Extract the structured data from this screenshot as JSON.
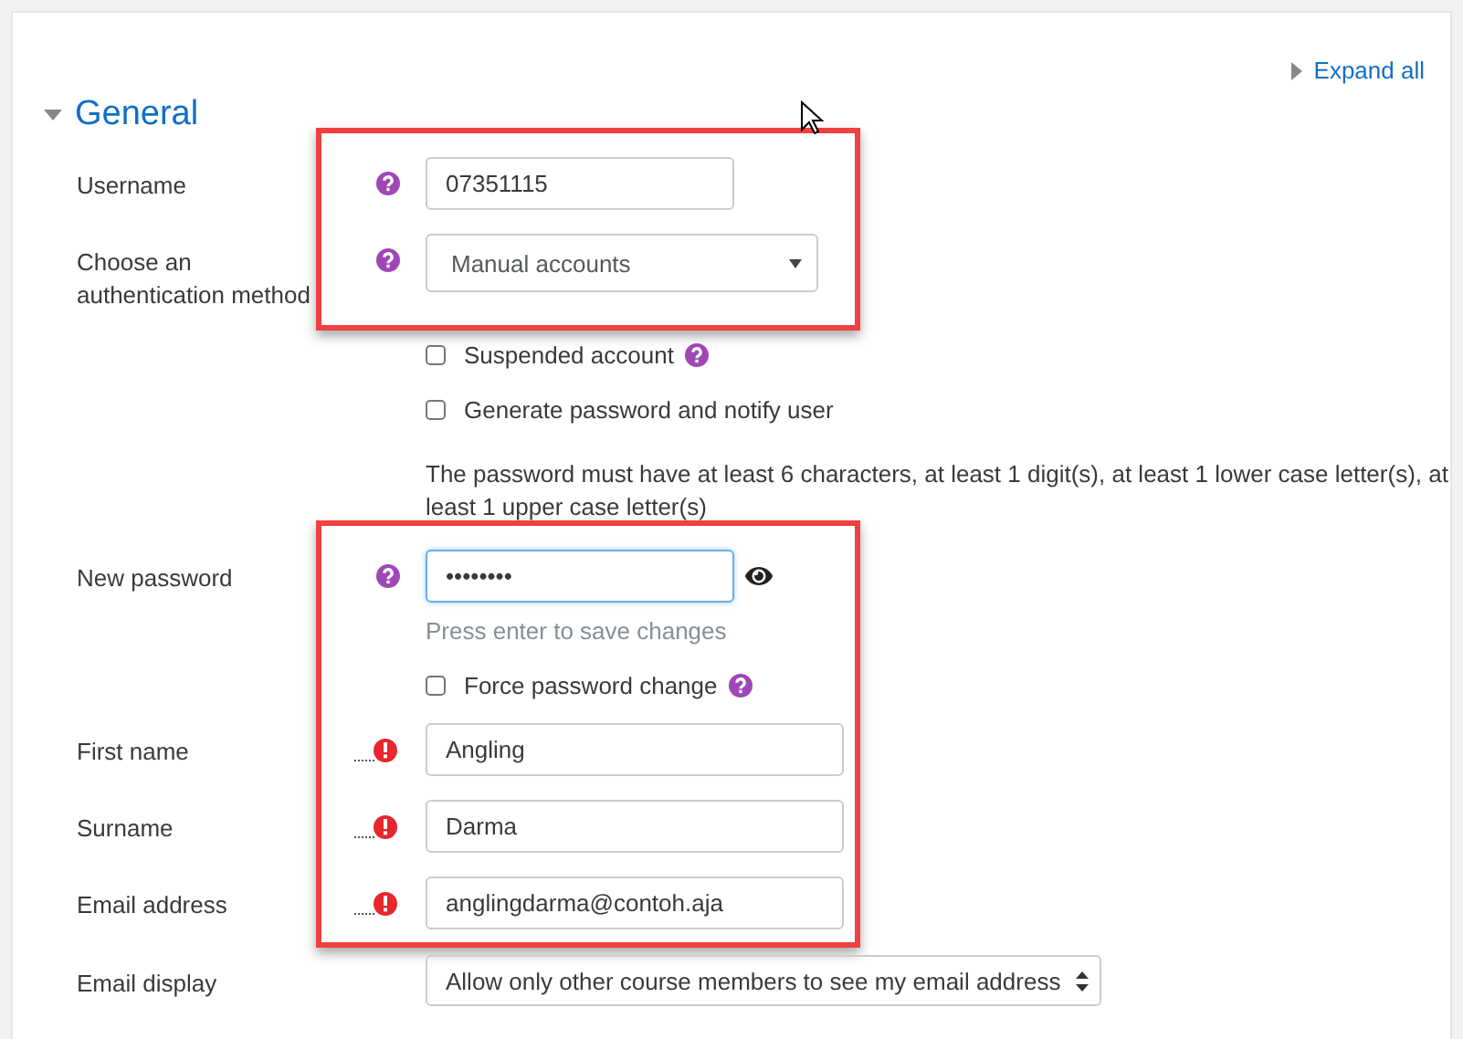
{
  "expand_link": {
    "label": "Expand all",
    "expanded": false
  },
  "section": {
    "title": "General",
    "expanded": true
  },
  "groups": [
    {
      "highlighted": true,
      "rows": [
        {
          "kind": "text",
          "label": "Username",
          "help": true,
          "invalid": false,
          "value": "07351115"
        },
        {
          "kind": "select",
          "label": "Choose an authentication method",
          "help": true,
          "invalid": false,
          "value": "Manual accounts"
        }
      ]
    },
    {
      "highlighted": false,
      "rows": [
        {
          "kind": "checkbox",
          "label": "Suspended account",
          "checked": false,
          "help": true
        },
        {
          "kind": "checkbox",
          "label": "Generate password and notify user",
          "checked": false,
          "help": false
        },
        {
          "kind": "note",
          "text": "The password must have at least 6 characters, at least 1 digit(s), at least 1 lower case letter(s), at least 1 upper case letter(s)"
        }
      ]
    },
    {
      "highlighted": true,
      "rows": [
        {
          "kind": "password",
          "label": "New password",
          "help": true,
          "invalid": false,
          "value": "••••••••",
          "hint": "Press enter to save changes"
        },
        {
          "kind": "checkbox",
          "label": "Force password change",
          "checked": false,
          "help": true
        },
        {
          "kind": "text",
          "label": "First name",
          "help": false,
          "invalid": true,
          "value": "Angling"
        },
        {
          "kind": "text",
          "label": "Surname",
          "help": false,
          "invalid": true,
          "value": "Darma"
        },
        {
          "kind": "text",
          "label": "Email address",
          "help": false,
          "invalid": true,
          "value": "anglingdarma@contoh.aja"
        }
      ]
    },
    {
      "highlighted": false,
      "rows": [
        {
          "kind": "spinselect",
          "label": "Email display",
          "help": false,
          "invalid": false,
          "value": "Allow only other course members to see my email address"
        }
      ]
    }
  ]
}
